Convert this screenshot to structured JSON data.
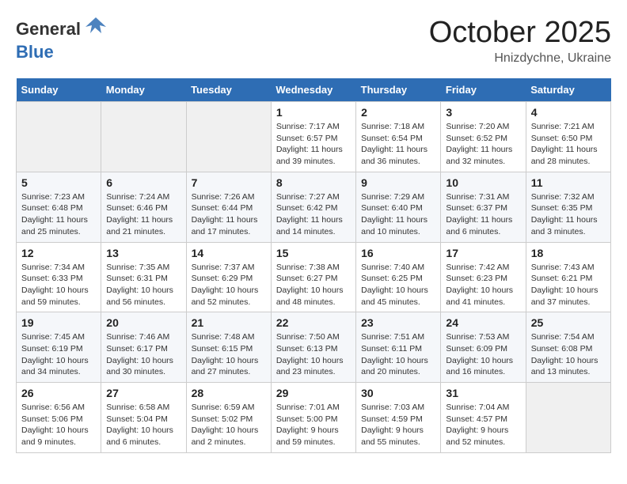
{
  "header": {
    "logo_general": "General",
    "logo_blue": "Blue",
    "month_title": "October 2025",
    "location": "Hnizdychne, Ukraine"
  },
  "days_of_week": [
    "Sunday",
    "Monday",
    "Tuesday",
    "Wednesday",
    "Thursday",
    "Friday",
    "Saturday"
  ],
  "weeks": [
    {
      "days": [
        {
          "number": "",
          "info": ""
        },
        {
          "number": "",
          "info": ""
        },
        {
          "number": "",
          "info": ""
        },
        {
          "number": "1",
          "info": "Sunrise: 7:17 AM\nSunset: 6:57 PM\nDaylight: 11 hours\nand 39 minutes."
        },
        {
          "number": "2",
          "info": "Sunrise: 7:18 AM\nSunset: 6:54 PM\nDaylight: 11 hours\nand 36 minutes."
        },
        {
          "number": "3",
          "info": "Sunrise: 7:20 AM\nSunset: 6:52 PM\nDaylight: 11 hours\nand 32 minutes."
        },
        {
          "number": "4",
          "info": "Sunrise: 7:21 AM\nSunset: 6:50 PM\nDaylight: 11 hours\nand 28 minutes."
        }
      ]
    },
    {
      "days": [
        {
          "number": "5",
          "info": "Sunrise: 7:23 AM\nSunset: 6:48 PM\nDaylight: 11 hours\nand 25 minutes."
        },
        {
          "number": "6",
          "info": "Sunrise: 7:24 AM\nSunset: 6:46 PM\nDaylight: 11 hours\nand 21 minutes."
        },
        {
          "number": "7",
          "info": "Sunrise: 7:26 AM\nSunset: 6:44 PM\nDaylight: 11 hours\nand 17 minutes."
        },
        {
          "number": "8",
          "info": "Sunrise: 7:27 AM\nSunset: 6:42 PM\nDaylight: 11 hours\nand 14 minutes."
        },
        {
          "number": "9",
          "info": "Sunrise: 7:29 AM\nSunset: 6:40 PM\nDaylight: 11 hours\nand 10 minutes."
        },
        {
          "number": "10",
          "info": "Sunrise: 7:31 AM\nSunset: 6:37 PM\nDaylight: 11 hours\nand 6 minutes."
        },
        {
          "number": "11",
          "info": "Sunrise: 7:32 AM\nSunset: 6:35 PM\nDaylight: 11 hours\nand 3 minutes."
        }
      ]
    },
    {
      "days": [
        {
          "number": "12",
          "info": "Sunrise: 7:34 AM\nSunset: 6:33 PM\nDaylight: 10 hours\nand 59 minutes."
        },
        {
          "number": "13",
          "info": "Sunrise: 7:35 AM\nSunset: 6:31 PM\nDaylight: 10 hours\nand 56 minutes."
        },
        {
          "number": "14",
          "info": "Sunrise: 7:37 AM\nSunset: 6:29 PM\nDaylight: 10 hours\nand 52 minutes."
        },
        {
          "number": "15",
          "info": "Sunrise: 7:38 AM\nSunset: 6:27 PM\nDaylight: 10 hours\nand 48 minutes."
        },
        {
          "number": "16",
          "info": "Sunrise: 7:40 AM\nSunset: 6:25 PM\nDaylight: 10 hours\nand 45 minutes."
        },
        {
          "number": "17",
          "info": "Sunrise: 7:42 AM\nSunset: 6:23 PM\nDaylight: 10 hours\nand 41 minutes."
        },
        {
          "number": "18",
          "info": "Sunrise: 7:43 AM\nSunset: 6:21 PM\nDaylight: 10 hours\nand 37 minutes."
        }
      ]
    },
    {
      "days": [
        {
          "number": "19",
          "info": "Sunrise: 7:45 AM\nSunset: 6:19 PM\nDaylight: 10 hours\nand 34 minutes."
        },
        {
          "number": "20",
          "info": "Sunrise: 7:46 AM\nSunset: 6:17 PM\nDaylight: 10 hours\nand 30 minutes."
        },
        {
          "number": "21",
          "info": "Sunrise: 7:48 AM\nSunset: 6:15 PM\nDaylight: 10 hours\nand 27 minutes."
        },
        {
          "number": "22",
          "info": "Sunrise: 7:50 AM\nSunset: 6:13 PM\nDaylight: 10 hours\nand 23 minutes."
        },
        {
          "number": "23",
          "info": "Sunrise: 7:51 AM\nSunset: 6:11 PM\nDaylight: 10 hours\nand 20 minutes."
        },
        {
          "number": "24",
          "info": "Sunrise: 7:53 AM\nSunset: 6:09 PM\nDaylight: 10 hours\nand 16 minutes."
        },
        {
          "number": "25",
          "info": "Sunrise: 7:54 AM\nSunset: 6:08 PM\nDaylight: 10 hours\nand 13 minutes."
        }
      ]
    },
    {
      "days": [
        {
          "number": "26",
          "info": "Sunrise: 6:56 AM\nSunset: 5:06 PM\nDaylight: 10 hours\nand 9 minutes."
        },
        {
          "number": "27",
          "info": "Sunrise: 6:58 AM\nSunset: 5:04 PM\nDaylight: 10 hours\nand 6 minutes."
        },
        {
          "number": "28",
          "info": "Sunrise: 6:59 AM\nSunset: 5:02 PM\nDaylight: 10 hours\nand 2 minutes."
        },
        {
          "number": "29",
          "info": "Sunrise: 7:01 AM\nSunset: 5:00 PM\nDaylight: 9 hours\nand 59 minutes."
        },
        {
          "number": "30",
          "info": "Sunrise: 7:03 AM\nSunset: 4:59 PM\nDaylight: 9 hours\nand 55 minutes."
        },
        {
          "number": "31",
          "info": "Sunrise: 7:04 AM\nSunset: 4:57 PM\nDaylight: 9 hours\nand 52 minutes."
        },
        {
          "number": "",
          "info": ""
        }
      ]
    }
  ]
}
